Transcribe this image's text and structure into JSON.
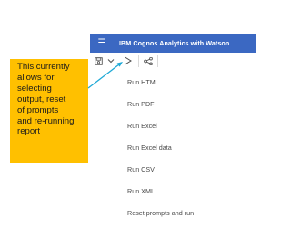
{
  "header": {
    "title": "IBM Cognos Analytics with Watson",
    "menu_icon": "hamburger-menu-icon",
    "background_color": "#3b68c2"
  },
  "toolbar": {
    "buttons": [
      {
        "icon": "save-icon"
      },
      {
        "icon": "chevron-down-icon"
      },
      {
        "icon": "run-play-icon"
      },
      {
        "icon": "share-icon"
      }
    ]
  },
  "run_menu": {
    "items": [
      "Run HTML",
      "Run PDF",
      "Run Excel",
      "Run Excel data",
      "Run CSV",
      "Run XML",
      "Reset prompts and run"
    ]
  },
  "callout": {
    "lines": [
      "This currently",
      "allows for",
      "selecting",
      "output, reset",
      "of prompts",
      "and re-running",
      "report"
    ],
    "background_color": "#ffc000",
    "arrow_color": "#1fa9d6"
  }
}
